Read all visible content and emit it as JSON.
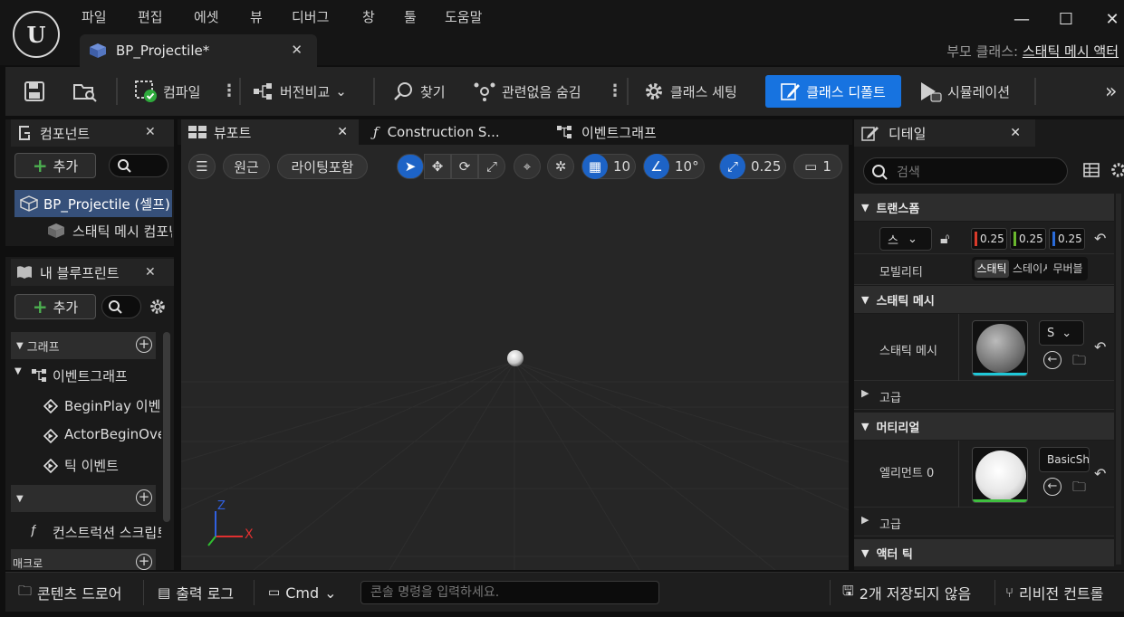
{
  "titlebar": {
    "logo": "unreal-logo",
    "menus": [
      "파일",
      "편집",
      "에셋",
      "뷰",
      "디버그",
      "창",
      "툴",
      "도움말"
    ],
    "window_controls": [
      "minimize",
      "maximize",
      "close"
    ],
    "doc_tab": "BP_Projectile*",
    "parent_label": "부모 클래스:",
    "parent_value": "스태틱 메시 액터"
  },
  "toolbar": {
    "compile": "컴파일",
    "diff": "버전비교",
    "find": "찾기",
    "hide_unrelated": "관련없음 숨김",
    "class_settings": "클래스 세팅",
    "class_defaults": "클래스 디폴트",
    "simulation": "시뮬레이션",
    "accent": "#1773e0"
  },
  "components_panel": {
    "title": "컴포넌트",
    "add": "추가",
    "items": [
      "BP_Projectile (셀프)",
      "스태틱 메시 컴포넌트"
    ]
  },
  "my_blueprint": {
    "title": "내 블루프린트",
    "add": "추가",
    "graph_header": "그래프",
    "event_graph": "이벤트그래프",
    "events": [
      "BeginPlay 이벤트",
      "ActorBeginOverlap",
      "틱 이벤트"
    ],
    "construction": "컨스트럭션 스크립트",
    "macros": "매크로"
  },
  "editor_tabs": {
    "viewport": "뷰포트",
    "construction": "Construction S...",
    "event_graph": "이벤트그래프"
  },
  "viewport": {
    "perspective": "원근",
    "lighting": "라이팅포함",
    "grid_snap": "10",
    "rotation_snap": "10°",
    "scale_snap": "0.25",
    "camera_speed": "1",
    "axis_x": "X",
    "axis_z": "Z"
  },
  "details": {
    "title": "디테일",
    "search_placeholder": "검색",
    "transform": "트랜스폼",
    "scale_mode": "스",
    "scale": [
      "0.25",
      "0.25",
      "0.25"
    ],
    "mobility_label": "모빌리티",
    "mobility_options": [
      "스태틱",
      "스테이셔너리",
      "무버블"
    ],
    "static_mesh_section": "스태틱 메시",
    "static_mesh_label": "스태틱 메시",
    "static_mesh_value": "S",
    "advanced": "고급",
    "materials_section": "머티리얼",
    "element_label": "엘리먼트 0",
    "element_value": "BasicShapeMaterial",
    "actor_tick": "액터 틱"
  },
  "statusbar": {
    "content_drawer": "콘텐츠 드로어",
    "output_log": "출력 로그",
    "cmd": "Cmd",
    "cmd_placeholder": "콘솔 명령을 입력하세요.",
    "unsaved": "2개 저장되지 않음",
    "revision": "리비전 컨트롤"
  }
}
